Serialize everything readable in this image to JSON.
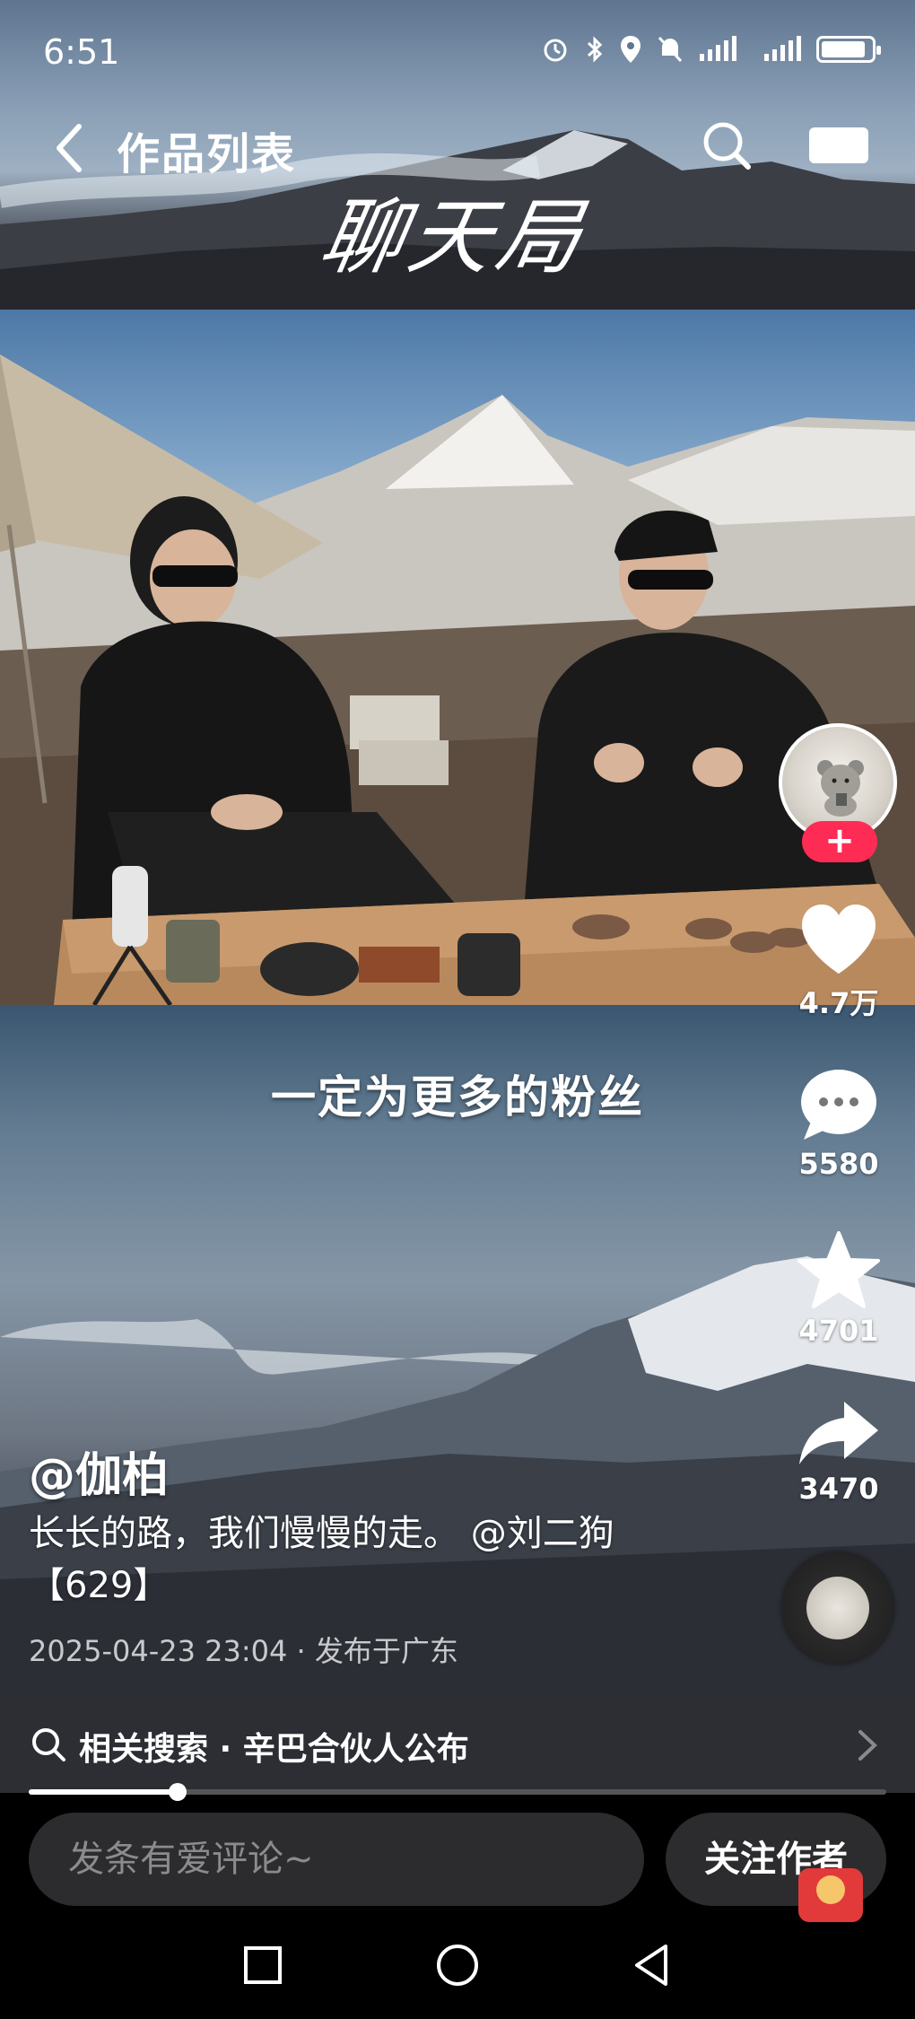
{
  "status_bar": {
    "time": "6:51",
    "icons": [
      "alarm-icon",
      "bluetooth-icon",
      "location-icon",
      "mute-icon",
      "signal-icon",
      "signal-icon",
      "battery-icon"
    ]
  },
  "header": {
    "title": "作品列表",
    "back_icon": "chevron-left-icon",
    "search_icon": "search-icon",
    "camera_icon": "camera-icon"
  },
  "banner": {
    "calligraphy": "聊天局"
  },
  "video": {
    "subtitle": "一定为更多的粉丝"
  },
  "actions": {
    "follow_plus": "+",
    "like_count": "4.7万",
    "comment_count": "5580",
    "favorite_count": "4701",
    "share_count": "3470"
  },
  "post": {
    "author": "@伽柏",
    "description": "长长的路，我们慢慢的走。 @刘二狗",
    "tag": "【629】",
    "meta": "2025-04-23 23:04 · 发布于广东"
  },
  "related": {
    "text": "相关搜索 · 辛巴合伙人公布"
  },
  "progress": {
    "fraction": 0.174
  },
  "comment_bar": {
    "placeholder": "发条有爱评论~",
    "follow_label": "关注作者"
  },
  "colors": {
    "accent": "#fe2c55",
    "background": "#000000",
    "bar": "#2c2e33"
  }
}
